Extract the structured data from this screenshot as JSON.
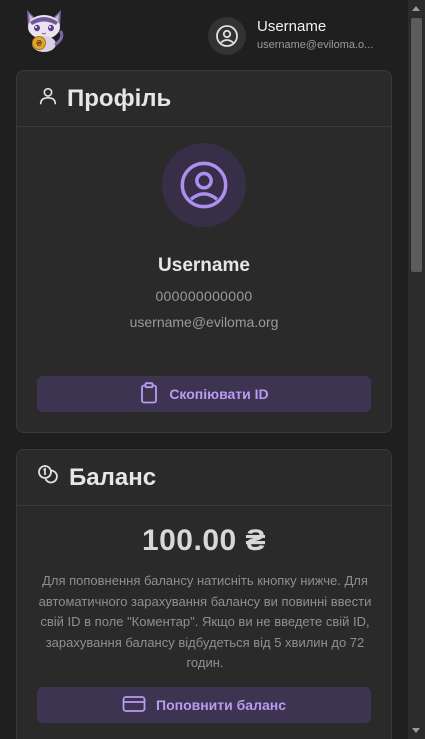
{
  "header": {
    "logo": {
      "icon": "cat-coin-mascot"
    },
    "user": {
      "icon": "user-circle-icon",
      "name": "Username",
      "email": "username@eviloma.o..."
    }
  },
  "profile": {
    "title": "Профіль",
    "title_icon": "user-icon",
    "avatar_icon": "user-circle-icon",
    "name": "Username",
    "id": "000000000000",
    "email": "username@eviloma.org",
    "copy_button": {
      "label": "Скопіювати ID",
      "icon": "clipboard-icon"
    }
  },
  "balance": {
    "title": "Баланс",
    "title_icon": "coins-icon",
    "amount": "100.00 ₴",
    "description": "Для поповнення балансу натисніть кнопку нижче. Для автоматичного зарахування балансу ви повинні ввести свій ID в поле \"Коментар\". Якщо ви не введете свій ID, зарахування балансу відбудеться від 5 хвилин до 72 годин.",
    "topup_button": {
      "label": "Поповнити баланс",
      "icon": "credit-card-icon"
    }
  },
  "colors": {
    "background": "#1f1f1f",
    "card": "#2a2a2a",
    "accent": "#b99cf0",
    "button_bg": "#3c3450"
  }
}
